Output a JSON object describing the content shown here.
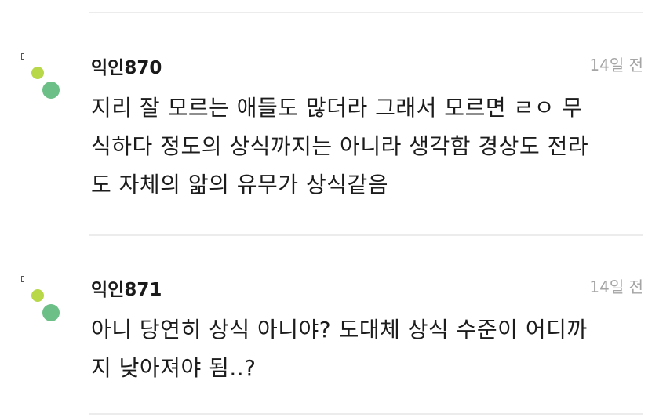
{
  "colors": {
    "dot_light": "#b8d84a",
    "dot_dark": "#6cbf87"
  },
  "comments": [
    {
      "avatar_icon": "anonymous-dots-icon",
      "author": "익인870",
      "time": "14일 전",
      "lines": [
        "지리 잘 모르는 애들도 많더라 그래서 모르면 ㄹㅇ 무",
        "식하다 정도의 상식까지는 아니라 생각함 경상도 전라",
        "도 자체의 앎의 유무가 상식같음"
      ]
    },
    {
      "avatar_icon": "anonymous-dots-icon",
      "author": "익인871",
      "time": "14일 전",
      "lines": [
        "아니 당연히 상식 아니야? 도대체 상식 수준이 어디까",
        "지 낮아져야 됨..?"
      ]
    }
  ]
}
